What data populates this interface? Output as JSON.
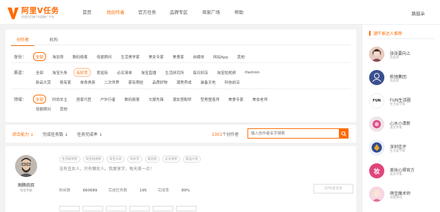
{
  "header": {
    "logo_title": "阿里V任务",
    "logo_sub": "阿里巴巴旗下内容推广平台",
    "nav": [
      "首页",
      "找创作者",
      "官方任务",
      "品牌专区",
      "商家广场",
      "帮助"
    ],
    "nav_active_index": 1,
    "user": "路鼓朵"
  },
  "tabs": [
    "创作者",
    "机构"
  ],
  "filters": {
    "identity": {
      "label": "身份：",
      "tags": [
        "全部",
        "淘女郎",
        "数码极客",
        "母婴顾问",
        "生活美学家",
        "美女专家",
        "美食家",
        "自媒体",
        "网站App",
        "其他"
      ]
    },
    "channel": {
      "label": "渠道：",
      "row1": [
        "全部",
        "淘宝头条",
        "有好货",
        "爱逛街",
        "必买清单",
        "淘宝直播",
        "生活研究所",
        "每日好店",
        "淘宝短视频",
        "ifashion"
      ],
      "row2": [
        "新品大赏",
        "极有家",
        "单身贵族",
        "二次世界",
        "家有萌娃",
        "品质好物",
        "潮男养成",
        "装备天地",
        "科技前沿"
      ]
    },
    "field": {
      "label": "领域：",
      "row1": [
        "全部",
        "时尚车主",
        "居家巧匠",
        "户外行者",
        "数码极客",
        "文娱先锋",
        "潮女搭配师",
        "型男塑造师",
        "美食专家",
        "美妆老师"
      ],
      "row2": [
        "母婴顾问",
        "其他"
      ]
    }
  },
  "sortbar": {
    "sorts": [
      "综合能力 ↓",
      "完成任务数 ↓",
      "任务完成率 ↓"
    ],
    "count_prefix": "1301",
    "count_suffix": "个创作者",
    "search_placeholder": "输入创作者名字搜索"
  },
  "card": {
    "name": "图腾叔叔",
    "role": "淘宝专家",
    "tags": [
      "生活研究所",
      "淘宝短视频",
      "淘宝头条",
      "有好货",
      "爱逛街",
      "必买清单",
      "新品大赏"
    ],
    "desc": "没有丑女人，只有懒女人。我瘦享字，每天美一点！",
    "fans_label": "粉丝数",
    "fans": "660689",
    "tasks_label": "完成任务数",
    "tasks": "195",
    "rate_label": "完成率",
    "rate": "89%",
    "invite": "向TA发任务"
  },
  "sidebar": {
    "title": "潮牛家达人推荐",
    "items": [
      {
        "name": "张张要向上",
        "role": "淘女郎",
        "bg": "#c98b86",
        "mark": ""
      },
      {
        "name": "栋驰集团",
        "role": "淘女郎",
        "bg": "#3a4f8f",
        "mark": ""
      },
      {
        "name": "FUN生活圈",
        "role": "生活美学家",
        "bg": "#ffffff",
        "mark": "FUN"
      },
      {
        "name": "心水小清新",
        "role": "美女专家",
        "bg": "#d8c0d0",
        "mark": ""
      },
      {
        "name": "深圳佳评",
        "role": "生活美学家",
        "bg": "#4b6cb0",
        "mark": ""
      },
      {
        "name": "美妆心得官方",
        "role": "美女专家",
        "bg": "#e0457b",
        "mark": "妆"
      },
      {
        "name": "萌宝魔术师",
        "role": "母婴顾问",
        "bg": "#e89ab6",
        "mark": ""
      }
    ]
  },
  "colors": {
    "accent": "#ff6a00"
  }
}
